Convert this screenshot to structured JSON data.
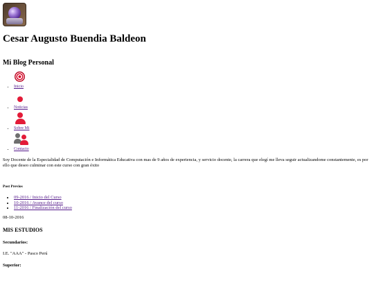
{
  "profile": {
    "name": "Cesar Augusto Buendia Baldeon",
    "blog_title": "Mi Blog Personal"
  },
  "nav": {
    "items": [
      {
        "label": "Inicio",
        "icon": "target-icon"
      },
      {
        "label": "Noticias",
        "icon": "dot-icon"
      },
      {
        "label": "Sobre Mi",
        "icon": "person-icon"
      },
      {
        "label": "Contacto",
        "icon": "people-icon"
      }
    ]
  },
  "bio": "Soy Docente de la Especialidad de Computación e Informática Educativa con mas de 9 años de experiencia, y servicio docente, la carrera que elegí me lleva seguir actualizandome constantemente, es por ello que deseo culminar con este curso con gran éxito",
  "posts": {
    "heading": "Post Previos",
    "items": [
      "09-2016 / Inicio del Curso",
      "10-2016 / Avance del curso",
      "11-2016 / Finalización del curso"
    ]
  },
  "entry": {
    "date": "08-10-2016",
    "heading": "MIS ESTUDIOS",
    "secundarios_label": "Secundarios:",
    "secundarios_value": "I.E. \"AAA\" - Pasco Perú",
    "superior_label": "Superior:"
  },
  "colors": {
    "link": "#551a8b",
    "icon_red": "#e31b38",
    "icon_gray": "#6f6f6f"
  }
}
